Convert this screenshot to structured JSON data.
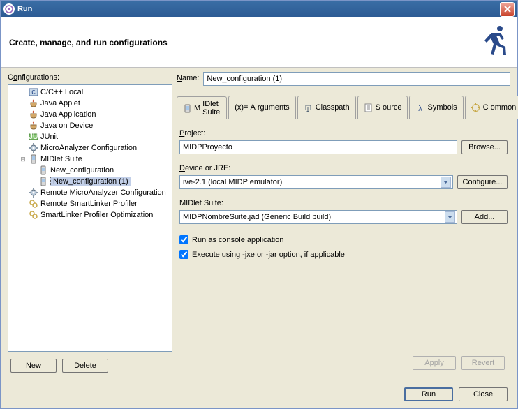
{
  "window": {
    "title": "Run"
  },
  "header": {
    "text": "Create, manage, and run configurations"
  },
  "configs": {
    "label_pre": "C",
    "label_u": "o",
    "label_post": "nfigurations:",
    "tree": [
      {
        "id": "cpp",
        "label": "C/C++ Local",
        "ind": 1
      },
      {
        "id": "japplet",
        "label": "Java Applet",
        "ind": 1
      },
      {
        "id": "japp",
        "label": "Java Application",
        "ind": 1
      },
      {
        "id": "jdev",
        "label": "Java on Device",
        "ind": 1
      },
      {
        "id": "junit",
        "label": "JUnit",
        "ind": 1
      },
      {
        "id": "micro",
        "label": "MicroAnalyzer Configuration",
        "ind": 1
      },
      {
        "id": "midlet",
        "label": "MIDlet Suite",
        "ind": 1,
        "exp": "-"
      },
      {
        "id": "nc",
        "label": "New_configuration",
        "ind": 2
      },
      {
        "id": "nc1",
        "label": "New_configuration (1)",
        "ind": 2,
        "sel": true
      },
      {
        "id": "rmicro",
        "label": "Remote MicroAnalyzer Configuration",
        "ind": 1
      },
      {
        "id": "rsl",
        "label": "Remote SmartLinker Profiler",
        "ind": 1
      },
      {
        "id": "slopt",
        "label": "SmartLinker Profiler Optimization",
        "ind": 1
      }
    ],
    "new_btn": "New",
    "new_u": "w",
    "del_btn": "Delete",
    "del_u": "t"
  },
  "form": {
    "name_label_u": "N",
    "name_label": "ame:",
    "name_value": "New_configuration (1)",
    "tabs": [
      {
        "id": "midlet",
        "u": "M",
        "label": "IDlet Suite",
        "active": true
      },
      {
        "id": "args",
        "pre": "(x)= ",
        "u": "A",
        "label": "rguments"
      },
      {
        "id": "cp",
        "label": "Classpath"
      },
      {
        "id": "src",
        "u": "S",
        "label": "ource"
      },
      {
        "id": "sym",
        "label": "Symbols"
      },
      {
        "id": "cmn",
        "u": "C",
        "label": "ommon"
      }
    ],
    "project_label_u": "P",
    "project_label": "roject:",
    "project_value": "MIDPProyecto",
    "browse": "Browse...",
    "browse_u": "B",
    "device_label": "Device or JRE:",
    "device_u": "D",
    "device_value": "ive-2.1 (local MIDP emulator)",
    "configure": "Configure...",
    "configure_u": "o",
    "suite_label": "MIDlet Suite:",
    "suite_value": "MIDPNombreSuite.jad (Generic Build build)",
    "add": "Add...",
    "ck1_u": "R",
    "ck1": "un as console application",
    "ck2_u": "E",
    "ck2": "xecute using -jxe or -jar option, if applicable",
    "apply": "Apply",
    "apply_u": "y",
    "revert": "Revert",
    "revert_u": "v"
  },
  "footer": {
    "run": "Run",
    "close": "Close"
  }
}
